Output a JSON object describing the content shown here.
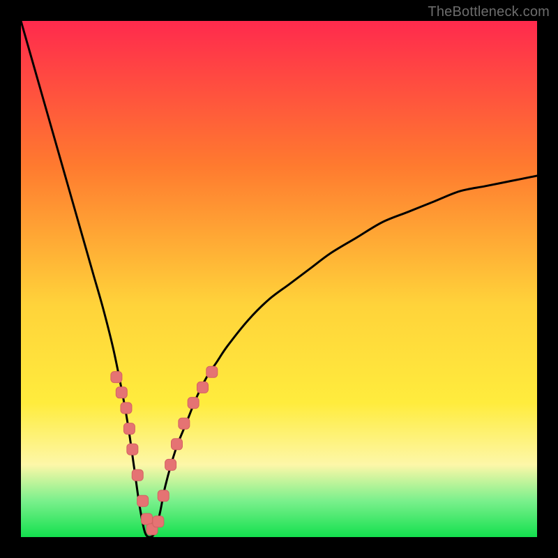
{
  "watermark": "TheBottleneck.com",
  "colors": {
    "grad_top": "#ff2a4d",
    "grad_mid_upper": "#ff7a2f",
    "grad_mid": "#ffd33a",
    "grad_yellow": "#ffec3d",
    "grad_pale": "#fdf7a8",
    "grad_green_light": "#7af08c",
    "grad_green": "#13e04e",
    "curve": "#000000",
    "marker_fill": "#e57373",
    "marker_stroke": "#d46262"
  },
  "chart_data": {
    "type": "line",
    "title": "",
    "xlabel": "",
    "ylabel": "",
    "xlim": [
      0,
      100
    ],
    "ylim": [
      0,
      100
    ],
    "series": [
      {
        "name": "bottleneck-curve",
        "x": [
          0,
          2,
          4,
          6,
          8,
          10,
          12,
          14,
          16,
          18,
          20,
          21,
          22,
          23,
          24,
          25,
          26,
          27,
          28,
          30,
          32,
          34,
          36,
          38,
          40,
          44,
          48,
          52,
          56,
          60,
          65,
          70,
          75,
          80,
          85,
          90,
          95,
          100
        ],
        "y": [
          100,
          93,
          86,
          79,
          72,
          65,
          58,
          51,
          44,
          36,
          26,
          20,
          13,
          6,
          1,
          0,
          1,
          5,
          10,
          17,
          22,
          27,
          31,
          34,
          37,
          42,
          46,
          49,
          52,
          55,
          58,
          61,
          63,
          65,
          67,
          68,
          69,
          70
        ]
      }
    ],
    "markers": {
      "name": "highlighted-points",
      "x": [
        18.5,
        19.5,
        20.4,
        21.0,
        21.6,
        22.6,
        23.6,
        24.4,
        25.4,
        26.6,
        27.6,
        29.0,
        30.2,
        31.6,
        33.4,
        35.2,
        37.0
      ],
      "y": [
        31,
        28,
        25,
        21,
        17,
        12,
        7,
        3.5,
        1.5,
        3,
        8,
        14,
        18,
        22,
        26,
        29,
        32
      ]
    },
    "gradient_stops": [
      {
        "pos": 0.0,
        "color": "#ff2a4d"
      },
      {
        "pos": 0.28,
        "color": "#ff7a2f"
      },
      {
        "pos": 0.55,
        "color": "#ffd33a"
      },
      {
        "pos": 0.74,
        "color": "#ffec3d"
      },
      {
        "pos": 0.86,
        "color": "#fdf7a8"
      },
      {
        "pos": 0.93,
        "color": "#7af08c"
      },
      {
        "pos": 1.0,
        "color": "#13e04e"
      }
    ]
  }
}
